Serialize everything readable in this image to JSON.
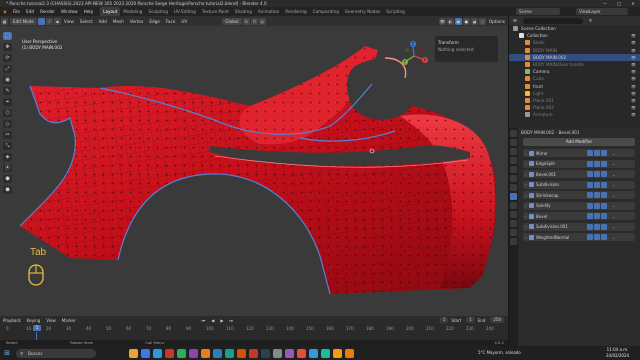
{
  "window": {
    "title": "* Porsche tutorial2.3 (CHASSIS).2023 API NEW 305 2023 2020 Porsche Serge Heritage\\Porsche tutorial2.blend] - Blender 4.0",
    "controls": [
      "—",
      "□",
      "✕"
    ]
  },
  "menubar": {
    "menus": [
      "File",
      "Edit",
      "Render",
      "Window",
      "Help"
    ],
    "workspaces": [
      "Layout",
      "Modeling",
      "Sculpting",
      "UV Editing",
      "Texture Paint",
      "Shading",
      "Animation",
      "Rendering",
      "Compositing",
      "Geometry Nodes",
      "Scripting"
    ],
    "active_workspace": "Layout",
    "scene": "Scene",
    "view_layer": "ViewLayer"
  },
  "viewport_header": {
    "mode": "Edit Mode",
    "menus": [
      "View",
      "Select",
      "Add",
      "Mesh",
      "Vertex",
      "Edge",
      "Face",
      "UV"
    ],
    "orientation": "Global",
    "options": "Options"
  },
  "viewport": {
    "perspective": "User Perspective",
    "object": "(1) BODY MAIN.002",
    "overlay_key": "Tab",
    "transform_panel": {
      "title": "Transform",
      "status": "Nothing selected"
    },
    "gizmo_axes": {
      "x": "X",
      "y": "Y",
      "z": "Z"
    },
    "tools": [
      "⬚",
      "✥",
      "⟳",
      "⤢",
      "▣",
      "✎",
      "⌖",
      "⬡",
      "◇",
      "✂",
      "⤡",
      "◈",
      "⦿",
      "⬢",
      "⬣"
    ]
  },
  "timeline": {
    "menus": [
      "Playback",
      "Keying",
      "View",
      "Marker"
    ],
    "current_frame": "1",
    "start_label": "Start",
    "start": "1",
    "end_label": "End",
    "end": "250",
    "ticks": [
      "0",
      "10",
      "20",
      "30",
      "40",
      "50",
      "60",
      "70",
      "80",
      "90",
      "100",
      "110",
      "120",
      "130",
      "140",
      "150",
      "160",
      "170",
      "180",
      "190",
      "200",
      "210",
      "220",
      "230",
      "240"
    ]
  },
  "statusbar": {
    "items": [
      "Select",
      "Rotate View",
      "Call Menu"
    ],
    "version": "4.0.2"
  },
  "outliner": {
    "rows": [
      {
        "label": "Scene Collection",
        "color": "#9a9a9a",
        "depth": 0,
        "selected": false,
        "dim": false
      },
      {
        "label": "Collection",
        "color": "#e0e0e0",
        "depth": 1,
        "selected": false,
        "dim": false
      },
      {
        "label": "Seats",
        "color": "#e58a3a",
        "depth": 2,
        "selected": false,
        "dim": true
      },
      {
        "label": "BODY MAIN",
        "color": "#e58a3a",
        "depth": 2,
        "selected": false,
        "dim": true
      },
      {
        "label": "BODY MAIN.002",
        "color": "#e58a3a",
        "depth": 2,
        "selected": true,
        "dim": false
      },
      {
        "label": "BODY MAIN.Door handle",
        "color": "#e58a3a",
        "depth": 2,
        "selected": false,
        "dim": true
      },
      {
        "label": "Camera",
        "color": "#7fbf6a",
        "depth": 2,
        "selected": false,
        "dim": false
      },
      {
        "label": "Cube",
        "color": "#e58a3a",
        "depth": 2,
        "selected": false,
        "dim": true
      },
      {
        "label": "front",
        "color": "#e58a3a",
        "depth": 2,
        "selected": false,
        "dim": false
      },
      {
        "label": "Light",
        "color": "#e5c03a",
        "depth": 2,
        "selected": false,
        "dim": true
      },
      {
        "label": "Plane.001",
        "color": "#e58a3a",
        "depth": 2,
        "selected": false,
        "dim": true
      },
      {
        "label": "Plane.002",
        "color": "#e58a3a",
        "depth": 2,
        "selected": false,
        "dim": true
      },
      {
        "label": "Armature",
        "color": "#9a9a9a",
        "depth": 2,
        "selected": false,
        "dim": true
      }
    ]
  },
  "properties": {
    "object": "BODY MAIN.002",
    "modifier": "Bevel.001",
    "add_modifier": "Add Modifier",
    "modifiers": [
      "Mirror",
      "EdgeSplit",
      "Bevel.001",
      "Subdivision",
      "Shrinkwrap",
      "Solidify",
      "Bevel",
      "Subdivision.001",
      "WeightedNormal"
    ]
  },
  "taskbar": {
    "search": "Buscar",
    "weather": "5°C  Mayorm. soleado",
    "time": "11:04 a.m.",
    "date": "24/02/2024",
    "apps": [
      "#e8a33a",
      "#3a7ae8",
      "#2a9bd9",
      "#c0392b",
      "#27ae60",
      "#8e44ad",
      "#e67e22",
      "#2980b9",
      "#16a085",
      "#d35400",
      "#c0392b",
      "#2c3e50",
      "#7f8c8d",
      "#9b59b6",
      "#e74c3c",
      "#3498db",
      "#1abc9c",
      "#f39c12",
      "#e87d0d"
    ]
  },
  "colors": {
    "accent": "#4772b3",
    "mesh": "#d4111c",
    "seam": "#5a7fd8"
  }
}
